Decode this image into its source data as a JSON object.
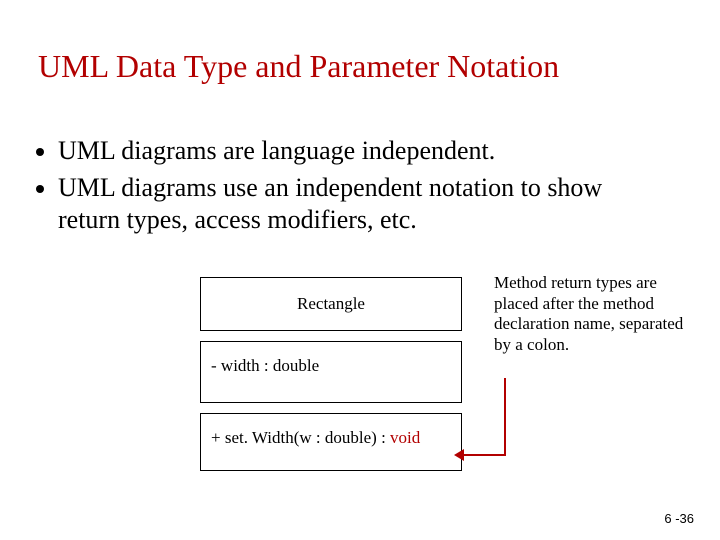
{
  "title": "UML Data Type and Parameter Notation",
  "bullets": [
    "UML diagrams are language independent.",
    "UML diagrams use an independent notation to show return types, access modifiers, etc."
  ],
  "uml": {
    "class_name": "Rectangle",
    "attribute": "- width : double",
    "operation_prefix": "+ set. Width(w : double) : ",
    "operation_return": "void"
  },
  "annotation": "Method return types are placed after the method declaration name, separated by a colon.",
  "page_number": "6 -36"
}
